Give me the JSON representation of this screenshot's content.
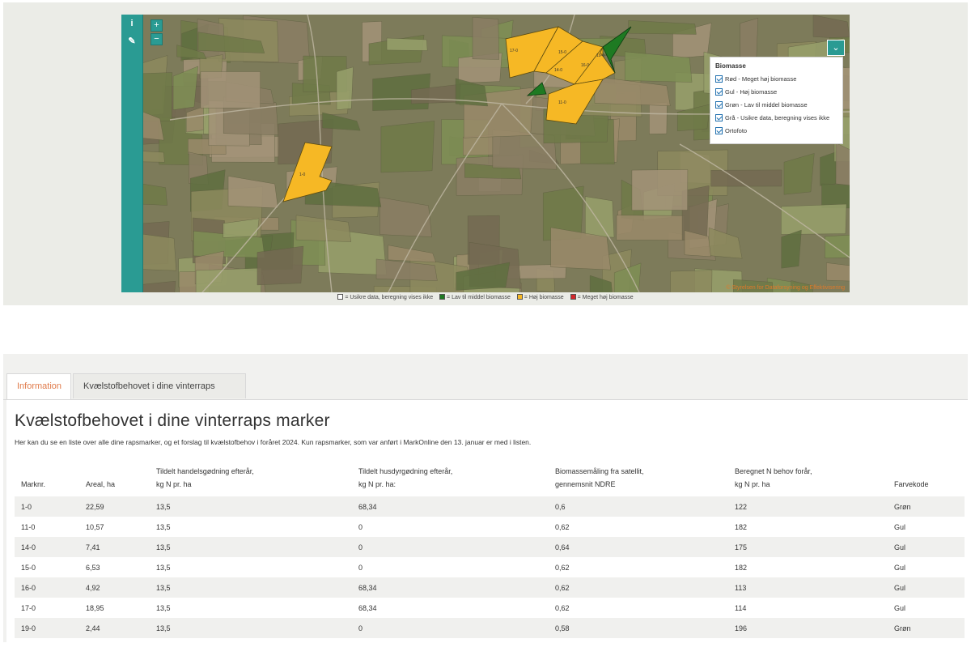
{
  "map": {
    "toolbar": {
      "info_icon": "info-icon",
      "edit_icon": "edit-icon"
    },
    "zoom": {
      "in_label": "+",
      "out_label": "−"
    },
    "layer_toggle": {
      "icon": "chevron-down-icon",
      "glyph": "⌄"
    },
    "field_labels": [
      "17-0",
      "15-0",
      "16-0",
      "19-0",
      "14-0",
      "1-0",
      "11-0"
    ],
    "layers_panel": {
      "title": "Biomasse",
      "items": [
        "Rød - Meget høj biomasse",
        "Gul - Høj biomasse",
        "Grøn - Lav til middel biomasse",
        "Grå - Usikre data, beregning vises ikke",
        "Ortofoto"
      ]
    },
    "copyright": "© Styrelsen for Dataforsyning og Effektivisering",
    "legend": [
      {
        "label": "= Usikre data, beregning vises ikke",
        "color": "#ffffff"
      },
      {
        "label": "= Lav til middel biomasse",
        "color": "#1e7a22"
      },
      {
        "label": "= Høj biomasse",
        "color": "#f6b825"
      },
      {
        "label": "= Meget høj biomasse",
        "color": "#d4262a"
      }
    ]
  },
  "tabs": [
    {
      "label": "Information",
      "active": true
    },
    {
      "label": "Kvælstofbehovet i dine vinterraps marker",
      "active": false
    }
  ],
  "page": {
    "title": "Kvælstofbehovet i dine vinterraps marker",
    "intro": "Her kan du se en liste over alle dine rapsmarker, og et forslag til kvælstofbehov i foråret 2024. Kun rapsmarker, som var anført i MarkOnline den 13. januar er med i listen."
  },
  "table": {
    "headers": [
      {
        "l1": "",
        "l2": "Marknr."
      },
      {
        "l1": "",
        "l2": "Areal, ha"
      },
      {
        "l1": "Tildelt handelsgødning efterår,",
        "l2": "kg N pr. ha"
      },
      {
        "l1": "Tildelt husdyrgødning efterår,",
        "l2": "kg N pr. ha:"
      },
      {
        "l1": "Biomassemåling fra satellit,",
        "l2": "gennemsnit NDRE"
      },
      {
        "l1": "Beregnet N behov forår,",
        "l2": "kg N pr. ha"
      },
      {
        "l1": "",
        "l2": "Farvekode"
      }
    ],
    "rows": [
      [
        "1-0",
        "22,59",
        "13,5",
        "68,34",
        "0,6",
        "122",
        "Grøn"
      ],
      [
        "11-0",
        "10,57",
        "13,5",
        "0",
        "0,62",
        "182",
        "Gul"
      ],
      [
        "14-0",
        "7,41",
        "13,5",
        "0",
        "0,64",
        "175",
        "Gul"
      ],
      [
        "15-0",
        "6,53",
        "13,5",
        "0",
        "0,62",
        "182",
        "Gul"
      ],
      [
        "16-0",
        "4,92",
        "13,5",
        "68,34",
        "0,62",
        "113",
        "Gul"
      ],
      [
        "17-0",
        "18,95",
        "13,5",
        "68,34",
        "0,62",
        "114",
        "Gul"
      ],
      [
        "19-0",
        "2,44",
        "13,5",
        "0",
        "0,58",
        "196",
        "Grøn"
      ]
    ]
  }
}
